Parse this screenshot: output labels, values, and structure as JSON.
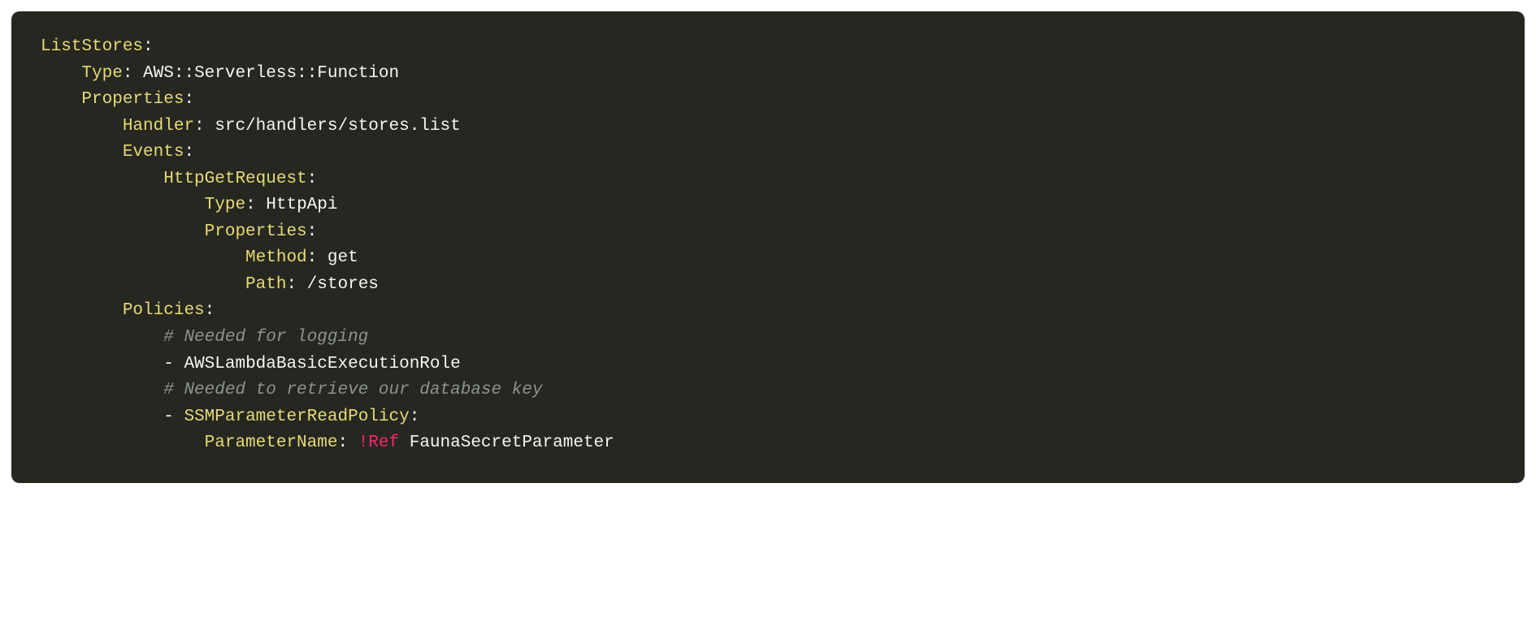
{
  "code": {
    "lines": [
      [
        {
          "cls": "key",
          "t": "ListStores"
        },
        {
          "cls": "pun",
          "t": ":"
        }
      ],
      [
        {
          "cls": "",
          "t": "    "
        },
        {
          "cls": "key",
          "t": "Type"
        },
        {
          "cls": "pun",
          "t": ":"
        },
        {
          "cls": "str",
          "t": " AWS::Serverless::Function"
        }
      ],
      [
        {
          "cls": "",
          "t": "    "
        },
        {
          "cls": "key",
          "t": "Properties"
        },
        {
          "cls": "pun",
          "t": ":"
        }
      ],
      [
        {
          "cls": "",
          "t": "        "
        },
        {
          "cls": "key",
          "t": "Handler"
        },
        {
          "cls": "pun",
          "t": ":"
        },
        {
          "cls": "str",
          "t": " src/handlers/stores.list"
        }
      ],
      [
        {
          "cls": "",
          "t": "        "
        },
        {
          "cls": "key",
          "t": "Events"
        },
        {
          "cls": "pun",
          "t": ":"
        }
      ],
      [
        {
          "cls": "",
          "t": "            "
        },
        {
          "cls": "key",
          "t": "HttpGetRequest"
        },
        {
          "cls": "pun",
          "t": ":"
        }
      ],
      [
        {
          "cls": "",
          "t": "                "
        },
        {
          "cls": "key",
          "t": "Type"
        },
        {
          "cls": "pun",
          "t": ":"
        },
        {
          "cls": "str",
          "t": " HttpApi"
        }
      ],
      [
        {
          "cls": "",
          "t": "                "
        },
        {
          "cls": "key",
          "t": "Properties"
        },
        {
          "cls": "pun",
          "t": ":"
        }
      ],
      [
        {
          "cls": "",
          "t": "                    "
        },
        {
          "cls": "key",
          "t": "Method"
        },
        {
          "cls": "pun",
          "t": ":"
        },
        {
          "cls": "str",
          "t": " get"
        }
      ],
      [
        {
          "cls": "",
          "t": "                    "
        },
        {
          "cls": "key",
          "t": "Path"
        },
        {
          "cls": "pun",
          "t": ":"
        },
        {
          "cls": "str",
          "t": " /stores"
        }
      ],
      [
        {
          "cls": "",
          "t": "        "
        },
        {
          "cls": "key",
          "t": "Policies"
        },
        {
          "cls": "pun",
          "t": ":"
        }
      ],
      [
        {
          "cls": "",
          "t": "            "
        },
        {
          "cls": "cmt",
          "t": "# Needed for logging"
        }
      ],
      [
        {
          "cls": "",
          "t": "            "
        },
        {
          "cls": "dash",
          "t": "- "
        },
        {
          "cls": "str",
          "t": "AWSLambdaBasicExecutionRole"
        }
      ],
      [
        {
          "cls": "",
          "t": "            "
        },
        {
          "cls": "cmt",
          "t": "# Needed to retrieve our database key"
        }
      ],
      [
        {
          "cls": "",
          "t": "            "
        },
        {
          "cls": "dash",
          "t": "- "
        },
        {
          "cls": "key",
          "t": "SSMParameterReadPolicy"
        },
        {
          "cls": "pun",
          "t": ":"
        }
      ],
      [
        {
          "cls": "",
          "t": "                "
        },
        {
          "cls": "key",
          "t": "ParameterName"
        },
        {
          "cls": "pun",
          "t": ":"
        },
        {
          "cls": "str",
          "t": " "
        },
        {
          "cls": "tag",
          "t": "!Ref"
        },
        {
          "cls": "str",
          "t": " FaunaSecretParameter"
        }
      ]
    ]
  }
}
